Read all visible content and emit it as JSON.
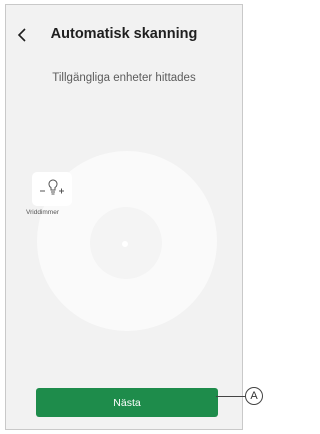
{
  "header": {
    "title": "Automatisk skanning",
    "back_icon": "chevron-left-icon"
  },
  "scan": {
    "status_text": "Tillgängliga enheter hittades"
  },
  "devices": [
    {
      "label": "Vriddimmer",
      "icon": "dimmer-bulb-icon"
    }
  ],
  "footer": {
    "next_label": "Nästa"
  },
  "callout": {
    "marker": "A"
  },
  "colors": {
    "accent": "#1e8c4b",
    "background": "#f2f2f2"
  }
}
